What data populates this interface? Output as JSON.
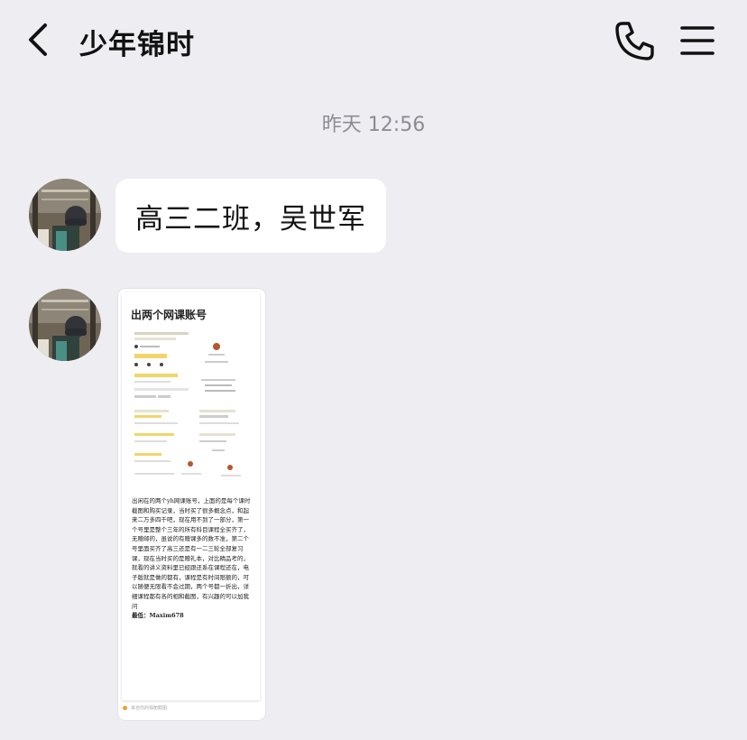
{
  "header": {
    "back_icon": "chevron-left-icon",
    "title": "少年锦时",
    "phone_icon": "phone-icon",
    "menu_icon": "hamburger-menu-icon"
  },
  "chat": {
    "timestamp": "昨天 12:56",
    "messages": [
      {
        "type": "text",
        "text": "高三二班，吴世军"
      },
      {
        "type": "image",
        "doc_title": "出两个网课账号",
        "doc_body": "出闲在的两个yh网课账号，上面的是每个课时截图和购买记录，当时买了很多概念点，和起来二万多四千吧，现在用不到了一部分，第一个号里是整个三年的所有科目课程全买齐了，无赠邮的，虽说的有赠课多的数不准，第二个号里面买齐了高三还是有一二三轮全部复习课，现在当时买的是赠礼本，对比精品考的，就看的讲义资料里已经跟还系在课程还在，电子版就是做的都有，课程是有时间限额的，可以随便无限看不会过期，两个号都一折出，详细课程都有各的相和截图，有兴趣的可以加我问",
        "doc_signature": "最低：Maxim678",
        "footnote": "来自你的相册截图"
      }
    ]
  },
  "colors": {
    "background": "#ededf2",
    "bubble": "#ffffff",
    "timestamp": "#8c8c93"
  }
}
